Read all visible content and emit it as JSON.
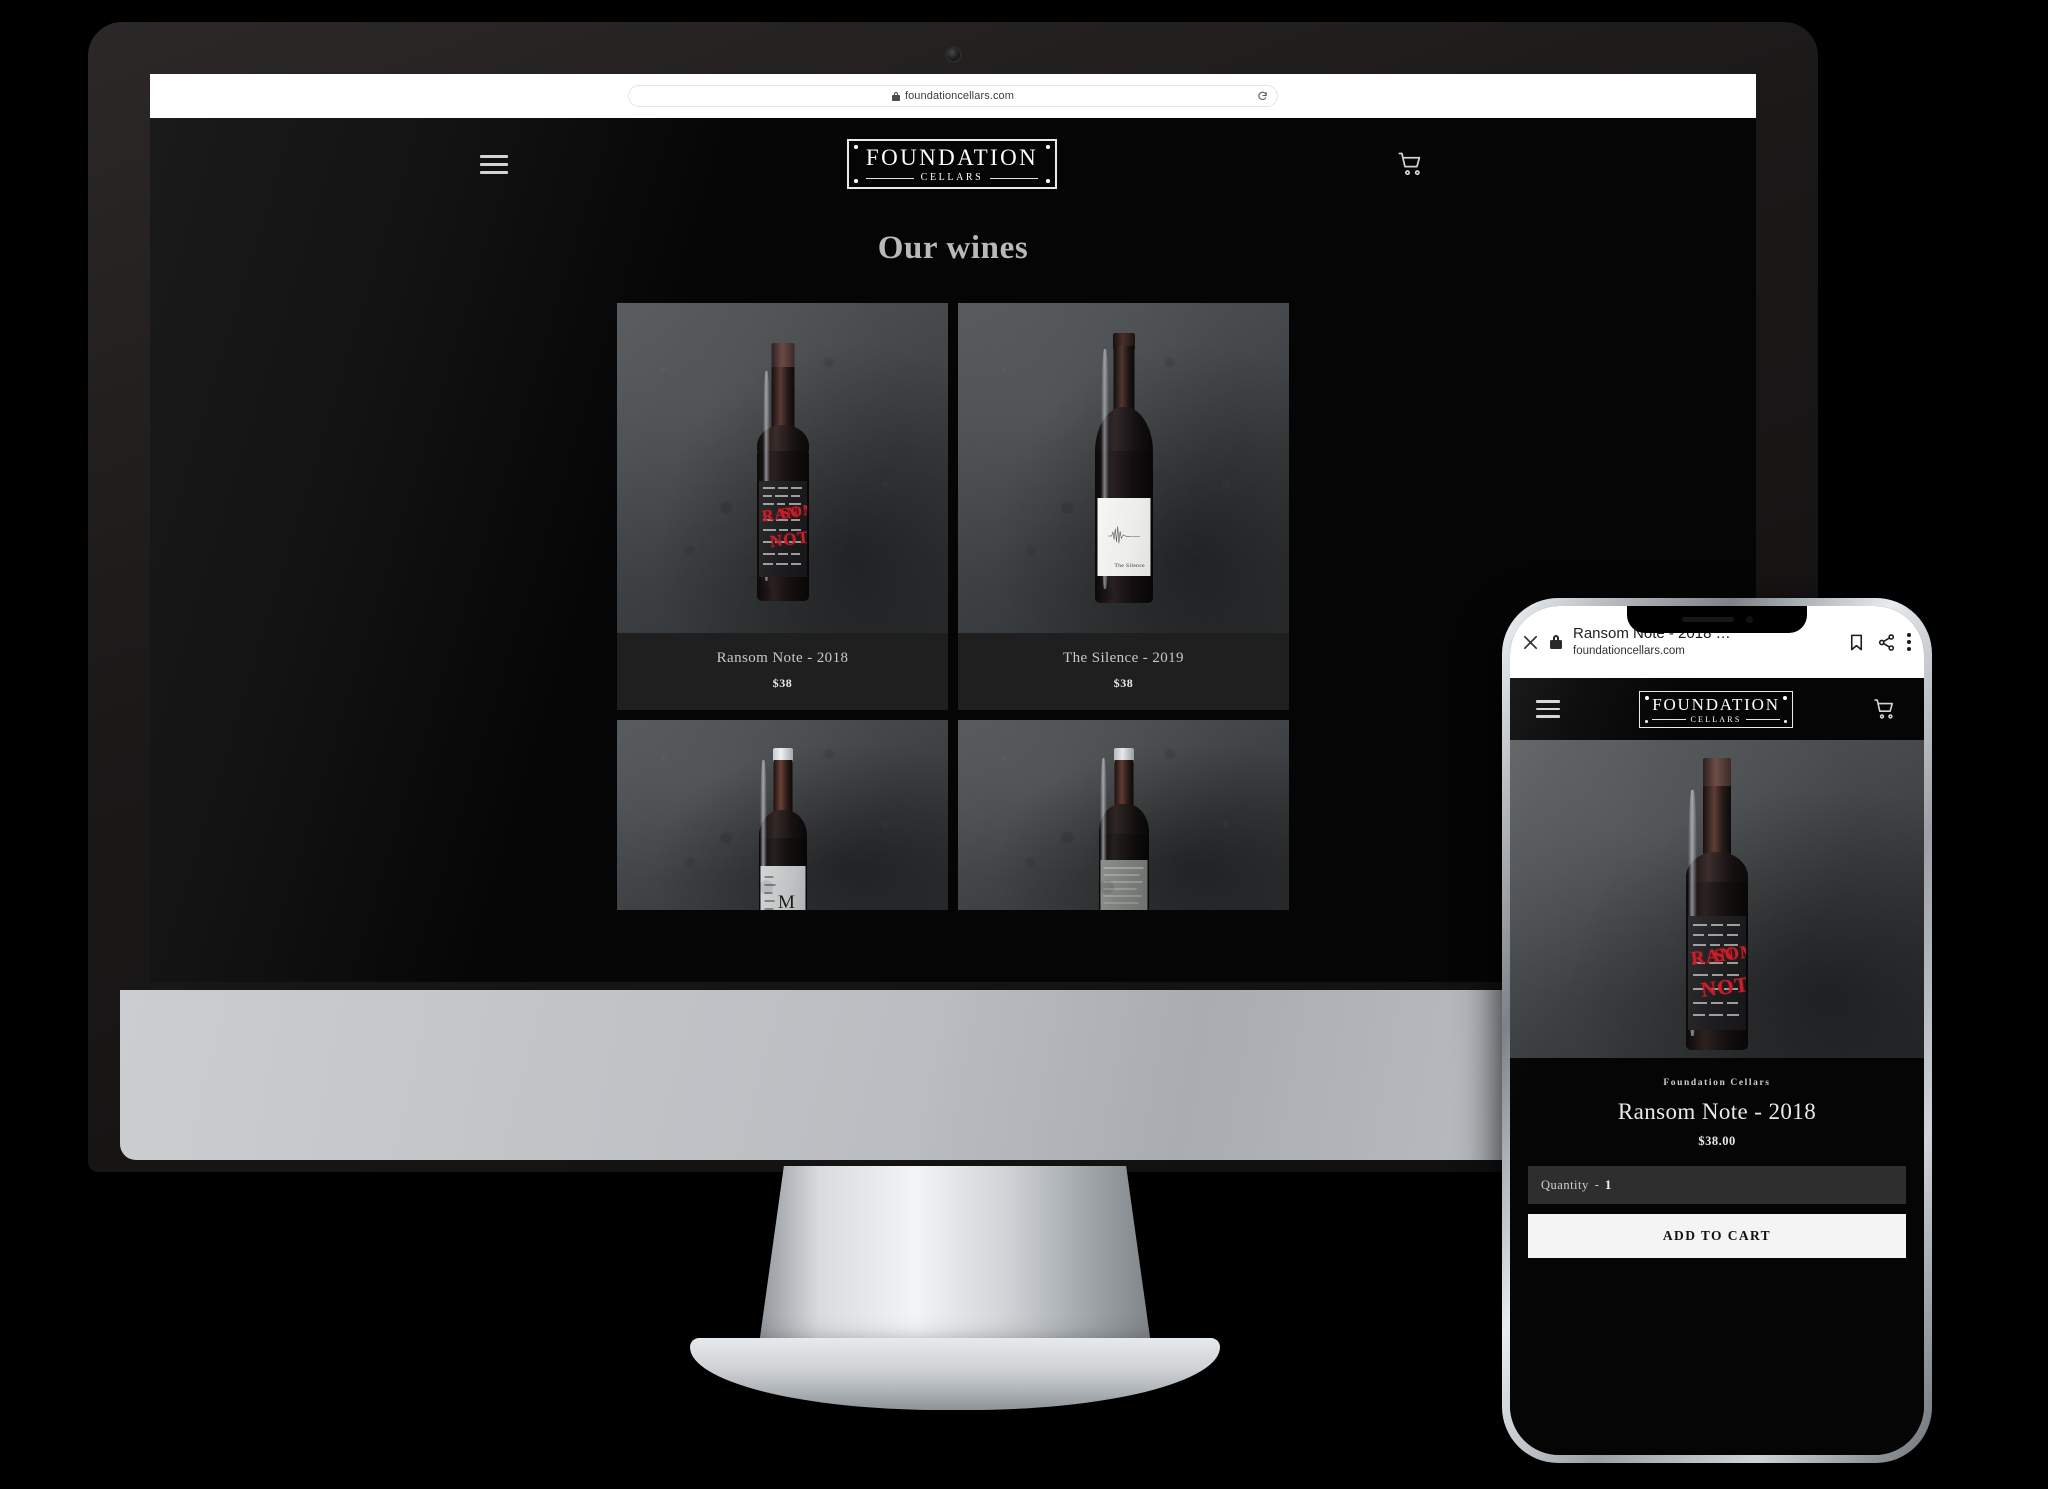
{
  "desktop": {
    "browser": {
      "url": "foundationcellars.com",
      "lock_icon": "lock-icon",
      "reload_icon": "reload-icon"
    },
    "site": {
      "menu_icon": "hamburger-menu-icon",
      "cart_icon": "shopping-cart-icon",
      "logo": {
        "main": "FOUNDATION",
        "sub": "CELLARS"
      },
      "page_title": "Our wines",
      "products": [
        {
          "name": "Ransom Note - 2018",
          "price": "$38",
          "label_style": "ransom-note"
        },
        {
          "name": "The Silence - 2019",
          "price": "$38",
          "label_style": "the-silence"
        },
        {
          "name": "",
          "price": "",
          "label_style": "mm"
        },
        {
          "name": "",
          "price": "",
          "label_style": "concrete"
        }
      ]
    }
  },
  "mobile": {
    "browser": {
      "close_icon": "close-icon",
      "lock_icon": "lock-icon",
      "title": "Ransom Note - 2018 …",
      "host": "foundationcellars.com",
      "bookmark_icon": "bookmark-icon",
      "share_icon": "share-icon",
      "overflow_icon": "overflow-menu-icon"
    },
    "site": {
      "menu_icon": "hamburger-menu-icon",
      "cart_icon": "shopping-cart-icon",
      "logo": {
        "main": "FOUNDATION",
        "sub": "CELLARS"
      },
      "product": {
        "brand": "Foundation Cellars",
        "name": "Ransom Note - 2018",
        "price": "$38.00",
        "quantity_label": "Quantity",
        "quantity_dash": "-",
        "quantity_value": "1",
        "add_to_cart": "ADD TO CART"
      }
    }
  },
  "devices": {
    "monitor_name": "desktop-monitor",
    "phone_name": "mobile-phone"
  },
  "colors": {
    "page_bg": "#000000",
    "site_bg": "#050505",
    "card_info_bg": "#1f1f1f",
    "text_muted": "#c8c8c8",
    "accent_red": "#c8202a",
    "chrome_white": "#ffffff"
  }
}
